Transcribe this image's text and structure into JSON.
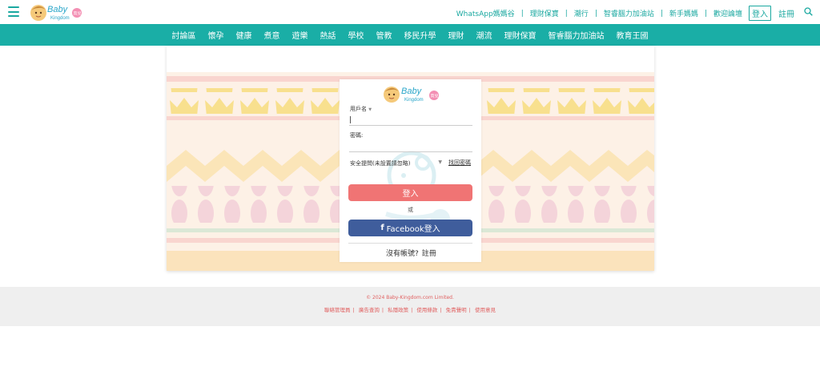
{
  "brand": {
    "logo_text": "Baby",
    "logo_sub": "Kingdom",
    "logo_badge": "育兒"
  },
  "header": {
    "top_links": [
      "WhatsApp媽媽谷",
      "理財保寶",
      "潮行",
      "智睿腦力加油站",
      "新手媽媽",
      "歡迎論壇"
    ],
    "login_label": "登入",
    "register_label": "註冊"
  },
  "nav": {
    "items": [
      "討論區",
      "懷孕",
      "健康",
      "煮意",
      "遊樂",
      "熱話",
      "學校",
      "管教",
      "移民升學",
      "理財",
      "潮流",
      "理財保寶",
      "智睿腦力加油站",
      "教育王國"
    ]
  },
  "login_form": {
    "username_label": "用戶名",
    "password_label": "密碼:",
    "security_question": "安全提問(未設置請忽略)",
    "forgot_password": "找回密碼",
    "submit_label": "登入",
    "or_label": "或",
    "facebook_label": "Facebook登入",
    "no_account_text": "沒有帳號?",
    "register_link": "註冊"
  },
  "footer": {
    "copyright": "© 2024 Baby-Kingdom.com Limited.",
    "links": [
      "聯絡管理員",
      "廣告查詢",
      "私隱政策",
      "使用條款",
      "免責聲明",
      "使用意見"
    ]
  },
  "colors": {
    "teal": "#1aaea6",
    "login_red": "#f07474",
    "facebook_blue": "#3f5d9c",
    "footer_text": "#e06060"
  }
}
